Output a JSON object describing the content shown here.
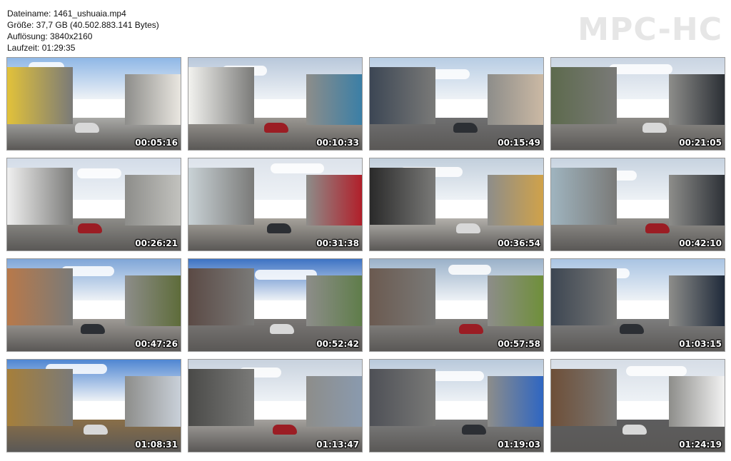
{
  "header": {
    "filename_line": "Dateiname: 1461_ushuaia.mp4",
    "size_line": "Größe: 37,7 GB (40.502.883.141 Bytes)",
    "resolution_line": "Auflösung: 3840x2160",
    "duration_line": "Laufzeit: 01:29:35"
  },
  "logo": "MPC-HC",
  "thumbnails": [
    {
      "time": "00:05:16",
      "sky": "#8fb7e6",
      "ground": "#a9a9a6",
      "left": "#e2c23a",
      "right": "#e9e6e0"
    },
    {
      "time": "00:10:33",
      "sky": "#b9c8db",
      "ground": "#9a9792",
      "left": "#f2f2ef",
      "right": "#3b7fa6"
    },
    {
      "time": "00:15:49",
      "sky": "#b8cde4",
      "ground": "#6f6f70",
      "left": "#3c4654",
      "right": "#cbb9a4"
    },
    {
      "time": "00:21:05",
      "sky": "#c9d4e2",
      "ground": "#8c8a86",
      "left": "#5d6a4d",
      "right": "#2b2f35"
    },
    {
      "time": "00:26:21",
      "sky": "#d3dce8",
      "ground": "#8d8c88",
      "left": "#f0f0f0",
      "right": "#c2c2be"
    },
    {
      "time": "00:31:38",
      "sky": "#dde3eb",
      "ground": "#a6a29b",
      "left": "#c9d2d6",
      "right": "#b11f2a"
    },
    {
      "time": "00:36:54",
      "sky": "#c2cfdc",
      "ground": "#b3b0ab",
      "left": "#2a2a2a",
      "right": "#d0a24a"
    },
    {
      "time": "00:42:10",
      "sky": "#c7d3e0",
      "ground": "#908e8a",
      "left": "#9fb4bf",
      "right": "#2d3137"
    },
    {
      "time": "00:47:26",
      "sky": "#7fa6d8",
      "ground": "#9e9a95",
      "left": "#b8794a",
      "right": "#5e6c3a"
    },
    {
      "time": "00:52:42",
      "sky": "#3d73c4",
      "ground": "#7a7775",
      "left": "#5b4a45",
      "right": "#5f7d4a"
    },
    {
      "time": "00:57:58",
      "sky": "#9ab1c9",
      "ground": "#858380",
      "left": "#6b5a50",
      "right": "#6f8f3a"
    },
    {
      "time": "01:03:15",
      "sky": "#a9c4e3",
      "ground": "#7d7d7d",
      "left": "#3d4652",
      "right": "#1f2a3a"
    },
    {
      "time": "01:08:31",
      "sky": "#4f86d2",
      "ground": "#8a6f48",
      "left": "#a67f3a",
      "right": "#c9d0d9"
    },
    {
      "time": "01:13:47",
      "sky": "#c8d2de",
      "ground": "#a4a19d",
      "left": "#4a4a48",
      "right": "#8a9aae"
    },
    {
      "time": "01:19:03",
      "sky": "#b9c9db",
      "ground": "#7c7c7c",
      "left": "#4e5056",
      "right": "#2f66c2"
    },
    {
      "time": "01:24:19",
      "sky": "#d6dde6",
      "ground": "#5d5d5e",
      "left": "#6e4f38",
      "right": "#f2f2f2"
    }
  ]
}
